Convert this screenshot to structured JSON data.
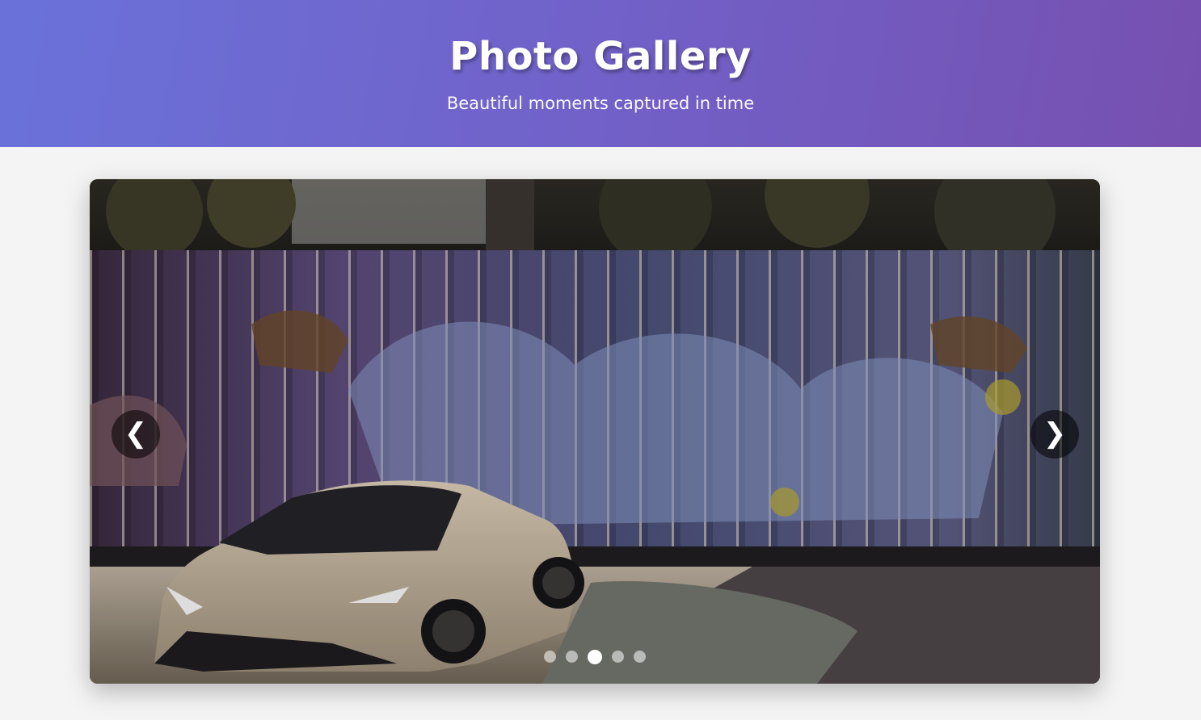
{
  "header": {
    "title": "Photo Gallery",
    "subtitle": "Beautiful moments captured in time"
  },
  "slider": {
    "prev_label": "❮",
    "next_label": "❯",
    "slide_count": 5,
    "active_index": 2,
    "current_image": "street-art-wall-with-sports-car"
  }
}
